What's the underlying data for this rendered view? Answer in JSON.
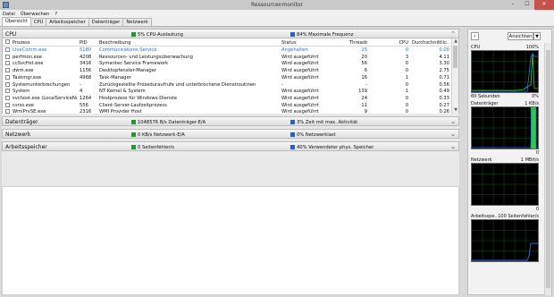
{
  "window": {
    "title": "Ressourcenmonitor",
    "minimize": "–",
    "maximize": "☐",
    "close": "✕"
  },
  "menu": [
    "Datei",
    "Überwachen",
    "?"
  ],
  "tabs": [
    "Übersicht",
    "CPU",
    "Arbeitsspeicher",
    "Datenträger",
    "Netzwerk"
  ],
  "cpu": {
    "title": "CPU",
    "stat1": {
      "text": "5% CPU-Auslastung",
      "color": "#1a9c2a"
    },
    "stat2": {
      "text": "84% Maximale Frequenz",
      "color": "#1e63d6"
    },
    "columns": [
      "Prozess",
      "PID",
      "Beschreibung",
      "Status",
      "Threads",
      "CPU",
      "Durchschnittlic..."
    ],
    "rows": [
      {
        "name": "LiveComm.exe",
        "pid": "5180",
        "desc": "Communications Service",
        "status": "Angehalten",
        "threads": "25",
        "cpu": "0",
        "avg": "0.00",
        "suspended": true
      },
      {
        "name": "perfmon.exe",
        "pid": "4208",
        "desc": "Ressourcen- und Leistungsüberwachung",
        "status": "Wird ausgeführt",
        "threads": "20",
        "cpu": "3",
        "avg": "4.11"
      },
      {
        "name": "ccSvcHst.exe",
        "pid": "3416",
        "desc": "Symantec Service Framework",
        "status": "Wird ausgeführt",
        "threads": "56",
        "cpu": "0",
        "avg": "3.30"
      },
      {
        "name": "dwm.exe",
        "pid": "1156",
        "desc": "Desktopfenster-Manager",
        "status": "Wird ausgeführt",
        "threads": "6",
        "cpu": "0",
        "avg": "2.75"
      },
      {
        "name": "Taskmgr.exe",
        "pid": "4968",
        "desc": "Task-Manager",
        "status": "Wird ausgeführt",
        "threads": "16",
        "cpu": "1",
        "avg": "0.71"
      },
      {
        "name": "Systemunterbrechungen",
        "pid": "-",
        "desc": "Zurückgestellte Prozeduraufrufe und unterbrochene Dienstroutinen",
        "status": "-",
        "threads": "-",
        "cpu": "0",
        "avg": "0.56"
      },
      {
        "name": "System",
        "pid": "4",
        "desc": "NT Kernel & System",
        "status": "Wird ausgeführt",
        "threads": "139",
        "cpu": "1",
        "avg": "0.49"
      },
      {
        "name": "svchost.exe (LocalServiceNo...",
        "pid": "1264",
        "desc": "Hostprozess für Windows-Dienste",
        "status": "Wird ausgeführt",
        "threads": "24",
        "cpu": "0",
        "avg": "0.33"
      },
      {
        "name": "csrss.exe",
        "pid": "556",
        "desc": "Client-Server-Laufzeitprozess",
        "status": "Wird ausgeführt",
        "threads": "11",
        "cpu": "0",
        "avg": "0.27"
      },
      {
        "name": "WmiPrvSE.exe",
        "pid": "2316",
        "desc": "WMI Provider Host",
        "status": "Wird ausgeführt",
        "threads": "9",
        "cpu": "0",
        "avg": "0.26"
      }
    ]
  },
  "disk": {
    "title": "Datenträger",
    "stat1": {
      "text": "1048576 B/s Datenträger-E/A",
      "color": "#1a9c2a"
    },
    "stat2": {
      "text": "3% Zeit mit max. Aktivität",
      "color": "#1e63d6"
    }
  },
  "network": {
    "title": "Netzwerk",
    "stat1": {
      "text": "0 KB/s Netzwerk-E/A",
      "color": "#1a9c2a"
    },
    "stat2": {
      "text": "0% Netzwerklast",
      "color": "#1e63d6"
    }
  },
  "memory": {
    "title": "Arbeitsspeicher",
    "stat1": {
      "text": "0 Seitenfehler/s",
      "color": "#1a9c2a"
    },
    "stat2": {
      "text": "40% Verwendeter phys. Speicher",
      "color": "#1e63d6"
    }
  },
  "right_panel": {
    "views_label": "Ansichten",
    "graphs": [
      {
        "label": "CPU",
        "value": "100%",
        "bottom_left": "60 Sekunden",
        "bottom_right": "0%"
      },
      {
        "label": "Datenträger",
        "value": "1 KB/s",
        "bottom_left": "",
        "bottom_right": "0"
      },
      {
        "label": "Netzwerk",
        "value": "1 MBit/s",
        "bottom_left": "",
        "bottom_right": "0"
      },
      {
        "label": "Arbeitsspe...",
        "value": "100 Seitenfehler/s",
        "bottom_left": "",
        "bottom_right": ""
      }
    ]
  },
  "colors": {
    "green": "#1a9c2a",
    "blue": "#1e63d6",
    "link": "#2f6fd1"
  }
}
